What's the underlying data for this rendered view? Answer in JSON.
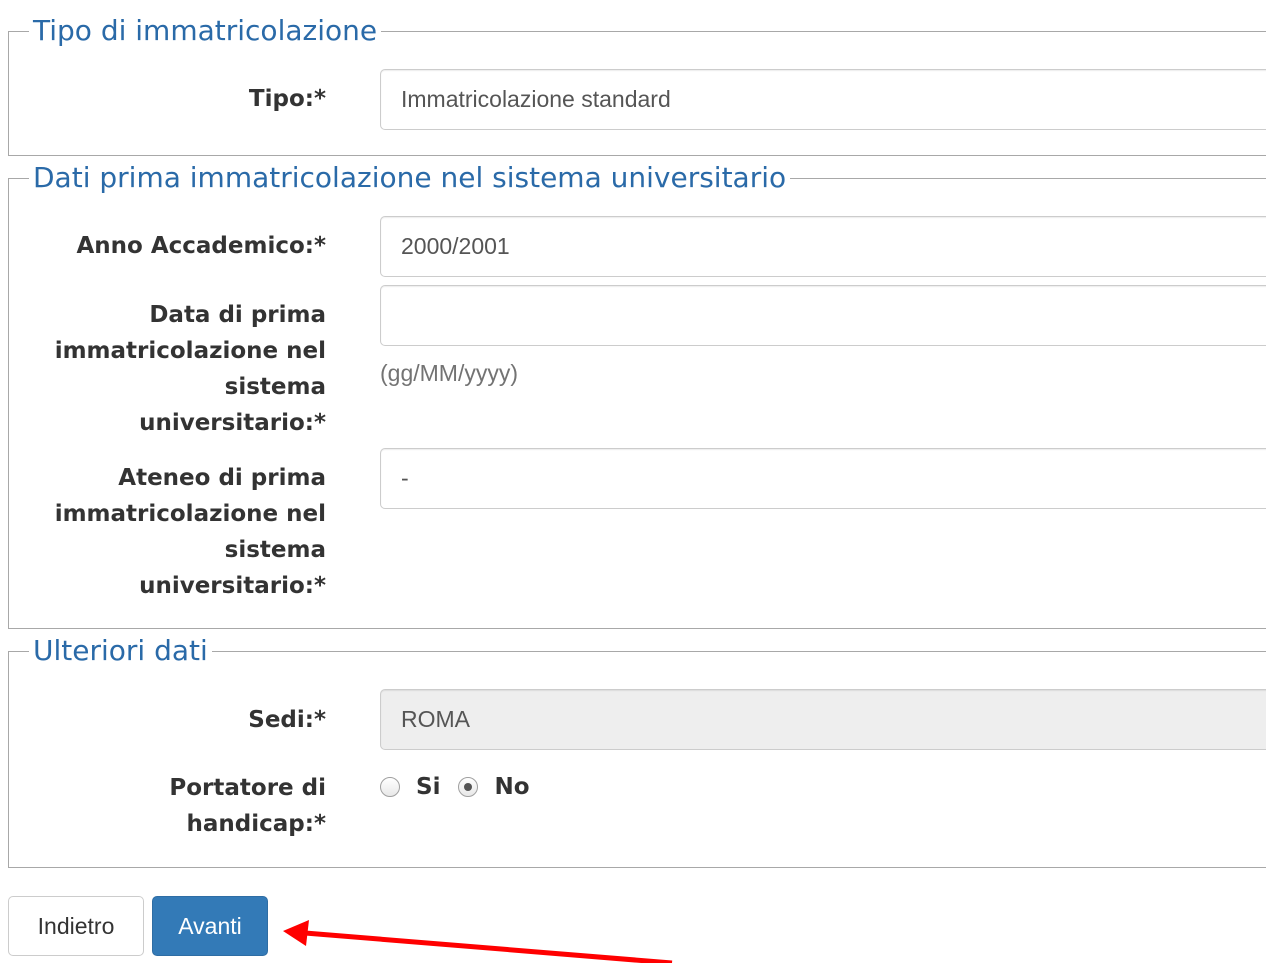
{
  "sections": {
    "tipo": {
      "legend": "Tipo di immatricolazione",
      "tipo_label": "Tipo:*",
      "tipo_value": "Immatricolazione standard"
    },
    "dati_prima": {
      "legend": "Dati prima immatricolazione nel sistema universitario",
      "anno_label": "Anno Accademico:*",
      "anno_value": "2000/2001",
      "data_label": "Data di prima immatricolazione nel sistema universitario:*",
      "data_value": "",
      "data_hint": "(gg/MM/yyyy)",
      "ateneo_label": "Ateneo di prima immatricolazione nel sistema universitario:*",
      "ateneo_value": "-"
    },
    "ulteriori": {
      "legend": "Ulteriori dati",
      "sedi_label": "Sedi:*",
      "sedi_value": "ROMA",
      "handicap_label": "Portatore di handicap:*",
      "options": [
        "Si",
        "No"
      ],
      "selected": "No"
    }
  },
  "buttons": {
    "back_label": "Indietro",
    "next_label": "Avanti"
  },
  "colors": {
    "legend": "#2a6aa8",
    "primary": "#337ab7",
    "annotation_arrow": "#ff0000"
  }
}
